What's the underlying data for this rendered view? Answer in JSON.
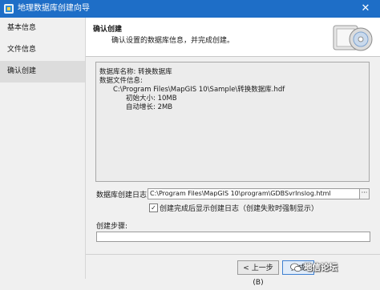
{
  "window": {
    "title": "地理数据库创建向导",
    "close_glyph": "✕"
  },
  "sidebar": {
    "items": [
      {
        "label": "基本信息"
      },
      {
        "label": "文件信息"
      },
      {
        "label": "确认创建"
      }
    ]
  },
  "header": {
    "title": "确认创建",
    "description": "确认设置的数据库信息，并完成创建。",
    "icon": "database-disk-icon"
  },
  "summary": {
    "lines": [
      "数据库名称: 转换数据库",
      "数据文件信息:",
      "C:\\Program Files\\MapGIS 10\\Sample\\转换数据库.hdf",
      "初始大小: 10MB",
      "自动增长: 2MB"
    ]
  },
  "log": {
    "label": "数据库创建日志:",
    "value": "C:\\Program Files\\MapGIS 10\\program\\GDBSvrInslog.html",
    "browse_label": "···"
  },
  "show_log": {
    "checked": true,
    "check_glyph": "✓",
    "label": "创建完成后显示创建日志（创建失败时强制显示）"
  },
  "steps": {
    "label": "创建步骤:"
  },
  "buttons": {
    "prev": "< 上一步(B)",
    "finish": "完成"
  },
  "watermark": {
    "text": "地信论坛"
  },
  "colors": {
    "titlebar": "#1e6ec7",
    "selected": "#dcdcdc"
  }
}
